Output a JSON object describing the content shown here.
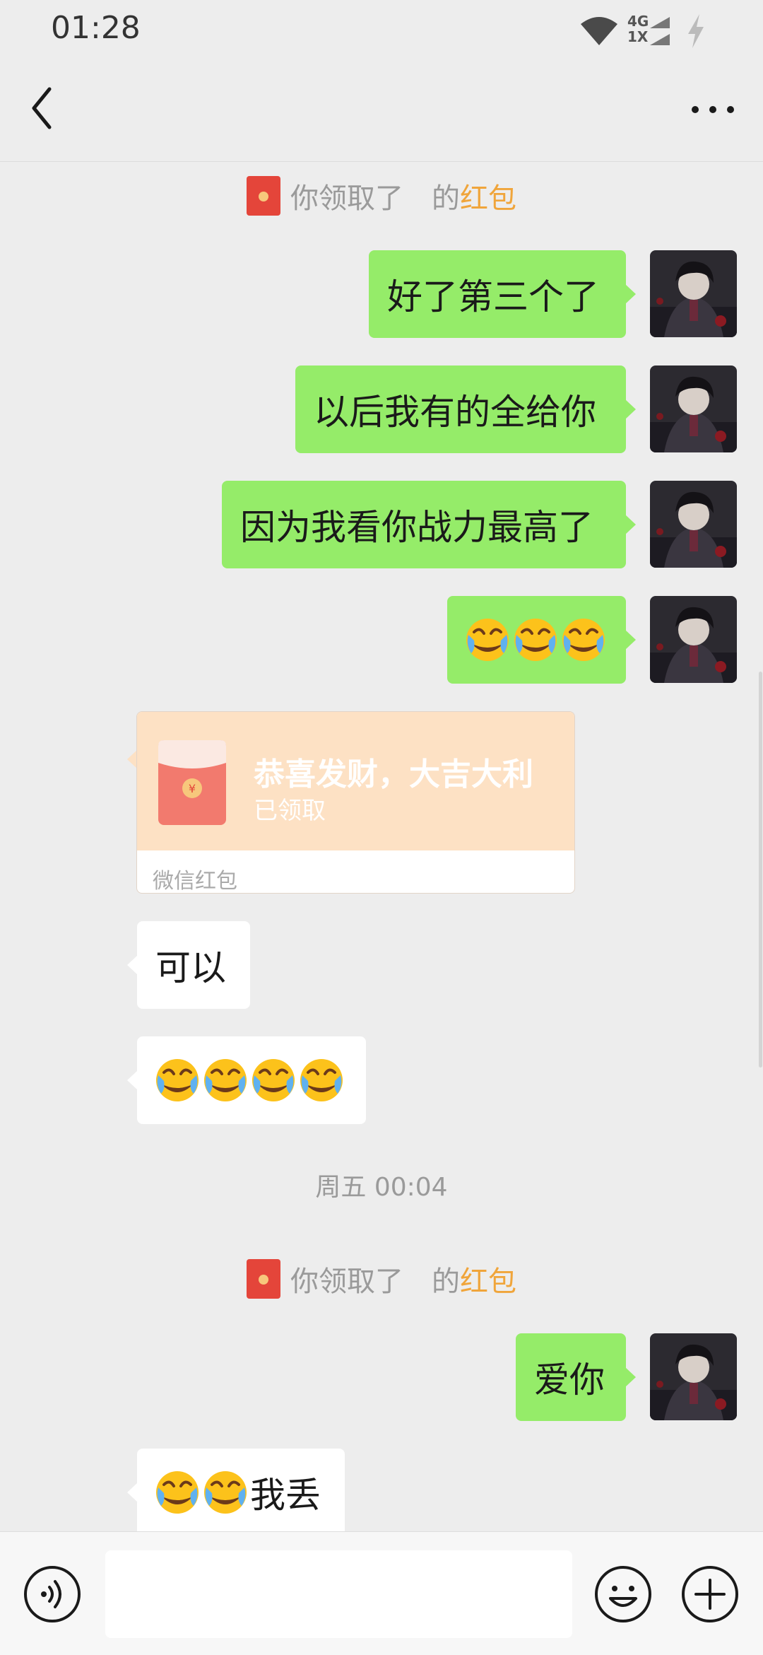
{
  "status_bar": {
    "time": "01:28",
    "network_top": "4G",
    "network_bottom": "1X"
  },
  "notices": [
    {
      "prefix": "你领取了",
      "suffix": "的",
      "highlight": "红包"
    },
    {
      "prefix": "你领取了",
      "suffix": "的",
      "highlight": "红包"
    }
  ],
  "messages": [
    {
      "text": "好了第三个了"
    },
    {
      "text": "以后我有的全给你"
    },
    {
      "text": "因为我看你战力最高了"
    },
    {
      "text": "可以"
    },
    {
      "text": "爱你"
    },
    {
      "text": "我丢"
    }
  ],
  "red_packet": {
    "title": "恭喜发财，大吉大利",
    "status": "已领取",
    "footer": "微信红包",
    "symbol": "¥"
  },
  "timestamp": "周五 00:04",
  "emoji_name": "face-with-tears-of-joy",
  "colors": {
    "outgoing_bubble": "#95ec69",
    "incoming_bubble": "#ffffff",
    "background": "#ededed",
    "red_packet": "#fde1c4",
    "highlight": "#f0a53b"
  }
}
